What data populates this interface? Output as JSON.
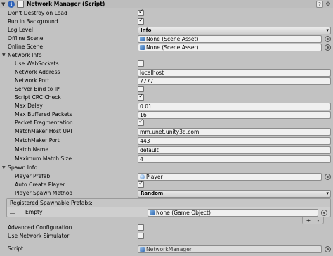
{
  "component": {
    "title": "Network Manager (Script)",
    "enabled": true,
    "help_icon": "help-icon",
    "settings_icon": "gear-icon"
  },
  "fields": {
    "dont_destroy": {
      "label": "Don't Destroy on Load",
      "checked": true
    },
    "run_background": {
      "label": "Run in Background",
      "checked": true
    },
    "log_level": {
      "label": "Log Level",
      "value": "Info"
    },
    "offline_scene": {
      "label": "Offline Scene",
      "value": "None (Scene Asset)"
    },
    "online_scene": {
      "label": "Online Scene",
      "value": "None (Scene Asset)"
    }
  },
  "network_info": {
    "label": "Network Info",
    "use_websockets": {
      "label": "Use WebSockets",
      "checked": false
    },
    "network_address": {
      "label": "Network Address",
      "value": "localhost"
    },
    "network_port": {
      "label": "Network Port",
      "value": "7777"
    },
    "server_bind": {
      "label": "Server Bind to IP",
      "checked": false
    },
    "script_crc": {
      "label": "Script CRC Check",
      "checked": true
    },
    "max_delay": {
      "label": "Max Delay",
      "value": "0.01"
    },
    "max_buffered": {
      "label": "Max Buffered Packets",
      "value": "16"
    },
    "packet_frag": {
      "label": "Packet Fragmentation",
      "checked": true
    },
    "mm_host": {
      "label": "MatchMaker Host URI",
      "value": "mm.unet.unity3d.com"
    },
    "mm_port": {
      "label": "MatchMaker Port",
      "value": "443"
    },
    "match_name": {
      "label": "Match Name",
      "value": "default"
    },
    "max_match": {
      "label": "Maximum Match Size",
      "value": "4"
    }
  },
  "spawn_info": {
    "label": "Spawn Info",
    "player_prefab": {
      "label": "Player Prefab",
      "value": "Player"
    },
    "auto_create": {
      "label": "Auto Create Player",
      "checked": true
    },
    "spawn_method": {
      "label": "Player Spawn Method",
      "value": "Random"
    },
    "registered": {
      "header": "Registered Spawnable Prefabs:",
      "rows": [
        {
          "label": "Empty",
          "value": "None (Game Object)"
        }
      ],
      "add_label": "+",
      "remove_label": "-"
    }
  },
  "advanced": {
    "label": "Advanced Configuration",
    "checked": false
  },
  "simulator": {
    "label": "Use Network Simulator",
    "checked": false
  },
  "script": {
    "label": "Script",
    "value": "NetworkManager"
  }
}
